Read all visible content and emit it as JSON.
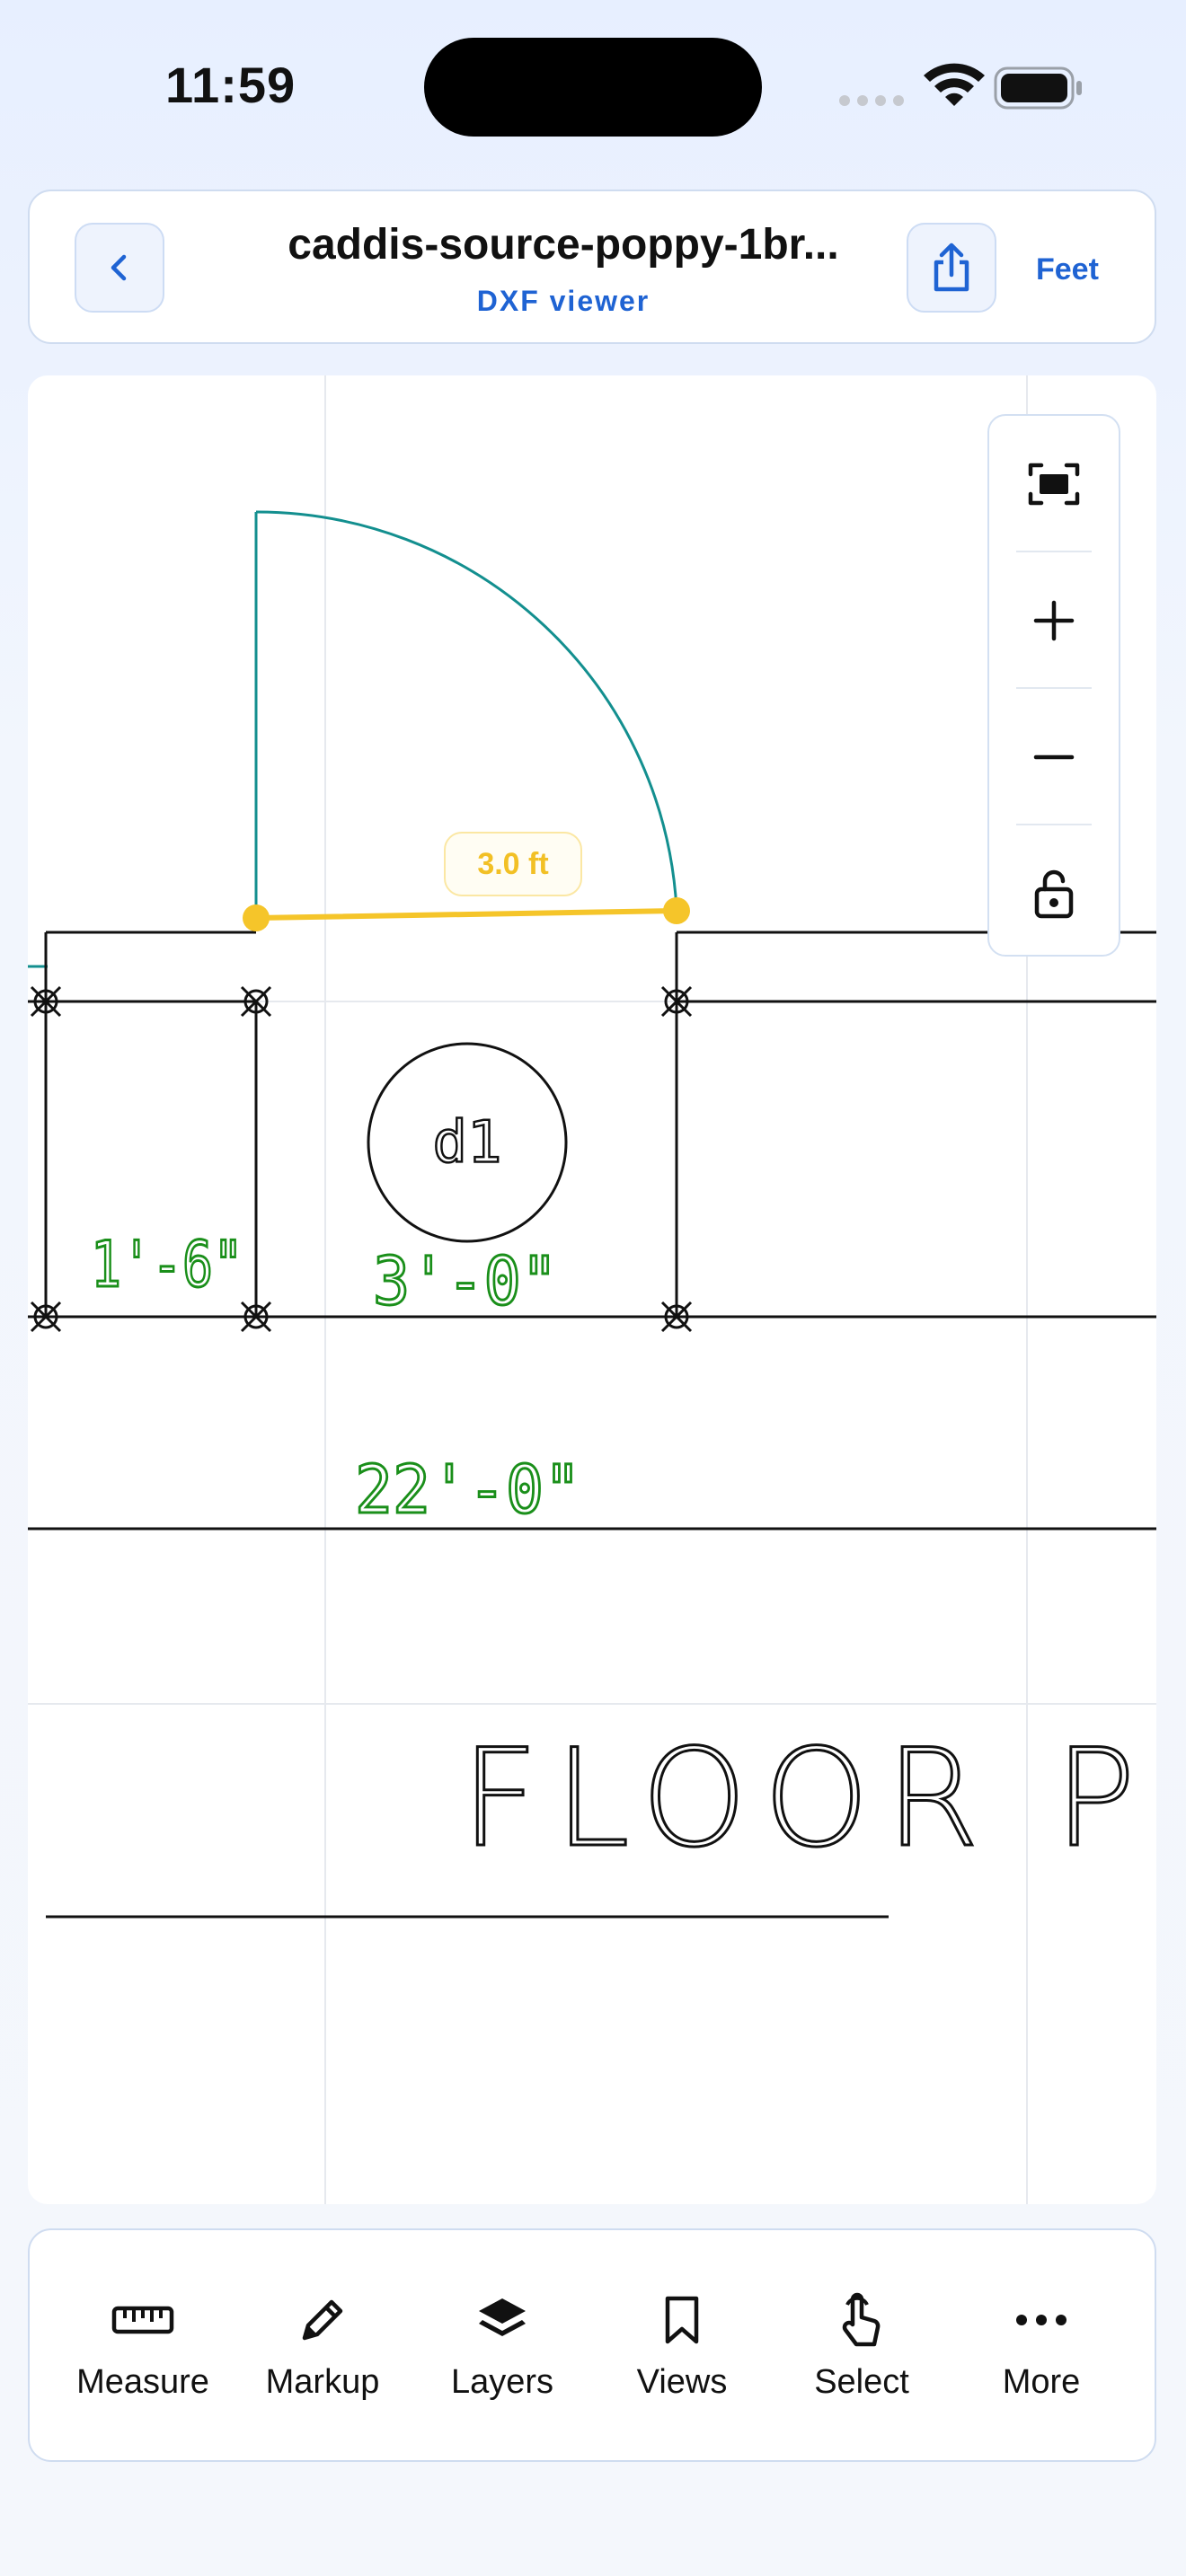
{
  "status": {
    "time": "11:59"
  },
  "header": {
    "title": "caddis-source-poppy-1br...",
    "subtitle": "DXF viewer",
    "units_label": "Feet"
  },
  "drawing": {
    "measurement_label": "3.0 ft",
    "room_labels": [
      "1'-6\"",
      "3'-0\"",
      "22'-0\""
    ],
    "title_text": "FLOOR PLAN",
    "door_tag": "d1",
    "colors": {
      "door_arc": "#138f8f",
      "measure": "#f5c52a",
      "dimension_text": "#1a8f1a",
      "line": "#111111"
    }
  },
  "zoom_controls": {
    "items": [
      "fit-screen-icon",
      "zoom-in-icon",
      "zoom-out-icon",
      "lock-icon"
    ]
  },
  "toolbar": {
    "items": [
      {
        "label": "Measure",
        "icon": "ruler-icon"
      },
      {
        "label": "Markup",
        "icon": "pencil-icon"
      },
      {
        "label": "Layers",
        "icon": "layers-icon"
      },
      {
        "label": "Views",
        "icon": "bookmark-icon"
      },
      {
        "label": "Select",
        "icon": "pointer-hand-icon"
      },
      {
        "label": "More",
        "icon": "more-dots-icon"
      }
    ]
  },
  "colors": {
    "accent": "#1f63d3",
    "card_border": "#cfdcf0"
  }
}
